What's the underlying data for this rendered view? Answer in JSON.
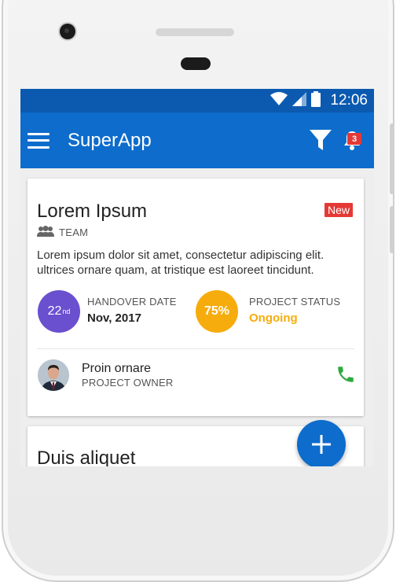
{
  "status_bar": {
    "time": "12:06"
  },
  "app_bar": {
    "title": "SuperApp",
    "notification_count": "3"
  },
  "project_card": {
    "title": "Lorem Ipsum",
    "tag": "New",
    "team_label": "TEAM",
    "description": "Lorem ipsum dolor sit amet, consectetur adipiscing elit. ultrices ornare quam, at tristique est laoreet tincidunt.",
    "handover": {
      "day": "22",
      "suffix": "nd",
      "label": "HANDOVER DATE",
      "value": "Nov, 2017"
    },
    "status": {
      "percent": "75%",
      "label": "PROJECT STATUS",
      "value": "Ongoing"
    },
    "owner": {
      "name": "Proin ornare",
      "role": "PROJECT OWNER"
    }
  },
  "second_card": {
    "title": "Duis aliquet"
  },
  "colors": {
    "primary": "#0d6ccc",
    "status_bar": "#0b5ab0",
    "accent_purple": "#6a4fcf",
    "accent_amber": "#f6ac0d",
    "badge_red": "#e53935",
    "call_green": "#2eaa3f"
  }
}
